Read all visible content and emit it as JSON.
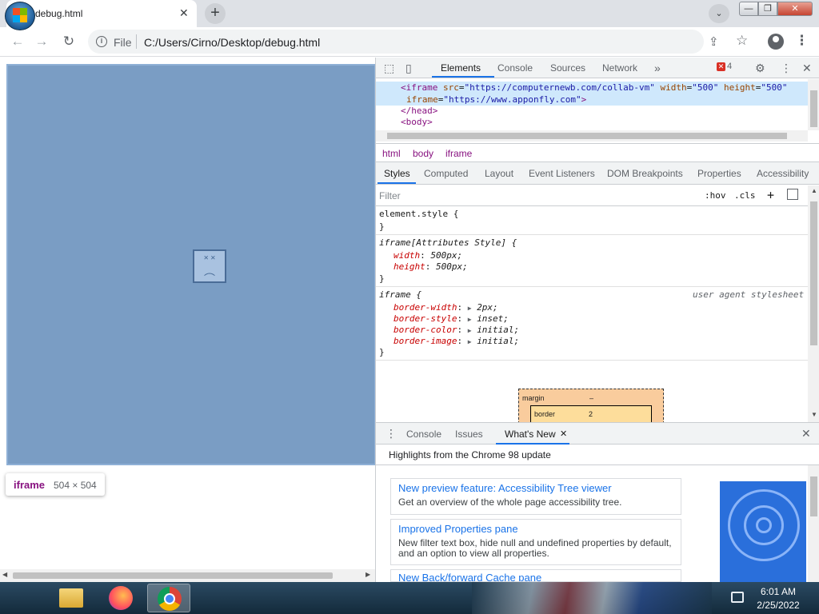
{
  "browser": {
    "tab_title": "debug.html",
    "tab_close": "✕",
    "new_tab": "+",
    "tab_search": "⌄",
    "win_min": "—",
    "win_max": "❐",
    "win_close": "✕",
    "nav_back": "←",
    "nav_forward": "→",
    "nav_reload": "↻",
    "scheme": "File",
    "url": "C:/Users/Cirno/Desktop/debug.html",
    "share": "⇪",
    "star": "☆",
    "menu": "⋮"
  },
  "page": {
    "sad_face": "˟ ˟\n︵",
    "tooltip_tag": "iframe",
    "tooltip_dims": "504 × 504"
  },
  "devtools": {
    "icons": {
      "inspect": "⬚",
      "device": "▯",
      "more_tabs": "»",
      "settings": "⚙",
      "kebab": "⋮",
      "close": "✕"
    },
    "tabs": [
      "Elements",
      "Console",
      "Sources",
      "Network"
    ],
    "error_count": "4",
    "elements": {
      "line1": {
        "open": "<iframe ",
        "a1": "src",
        "v1": "\"https://computernewb.com/collab-vm\"",
        "a2": "width",
        "v2": "\"500\"",
        "a3": "height",
        "v3": "\"500\""
      },
      "line2": {
        "a1": "iframe",
        "v1": "\"https://www.apponfly.com\"",
        "close": ">"
      },
      "line3": "</head>",
      "line4": "<body>"
    },
    "breadcrumbs": [
      "html",
      "body",
      "iframe"
    ],
    "subtabs": [
      "Styles",
      "Computed",
      "Layout",
      "Event Listeners",
      "DOM Breakpoints",
      "Properties",
      "Accessibility"
    ],
    "filter_placeholder": "Filter",
    "hov": ":hov",
    "cls": ".cls",
    "plus": "+",
    "rules": {
      "r1_selector": "element.style {",
      "brace": "}",
      "r2_selector": "iframe[Attributes Style] {",
      "r2_p1": "width",
      "r2_v1": "500px;",
      "r2_p2": "height",
      "r2_v2": "500px;",
      "r3_selector": "iframe {",
      "r3_source": "user agent stylesheet",
      "r3_p1": "border-width",
      "r3_v1": "2px;",
      "r3_p2": "border-style",
      "r3_v2": "inset;",
      "r3_p3": "border-color",
      "r3_v3": "initial;",
      "r3_p4": "border-image",
      "r3_v4": "initial;"
    },
    "box_model": {
      "margin_label": "margin",
      "margin_value": "–",
      "border_label": "border",
      "border_value": "2"
    },
    "drawer": {
      "tabs": [
        "Console",
        "Issues",
        "What's New"
      ],
      "heading": "Highlights from the Chrome 98 update",
      "cards": [
        {
          "title": "New preview feature: Accessibility Tree viewer",
          "desc": "Get an overview of the whole page accessibility tree."
        },
        {
          "title": "Improved Properties pane",
          "desc": "New filter text box, hide null and undefined properties by default, and an option to view all properties."
        },
        {
          "title": "New Back/forward Cache pane",
          "desc": ""
        }
      ]
    }
  },
  "taskbar": {
    "time": "6:01 AM",
    "date": "2/25/2022"
  }
}
